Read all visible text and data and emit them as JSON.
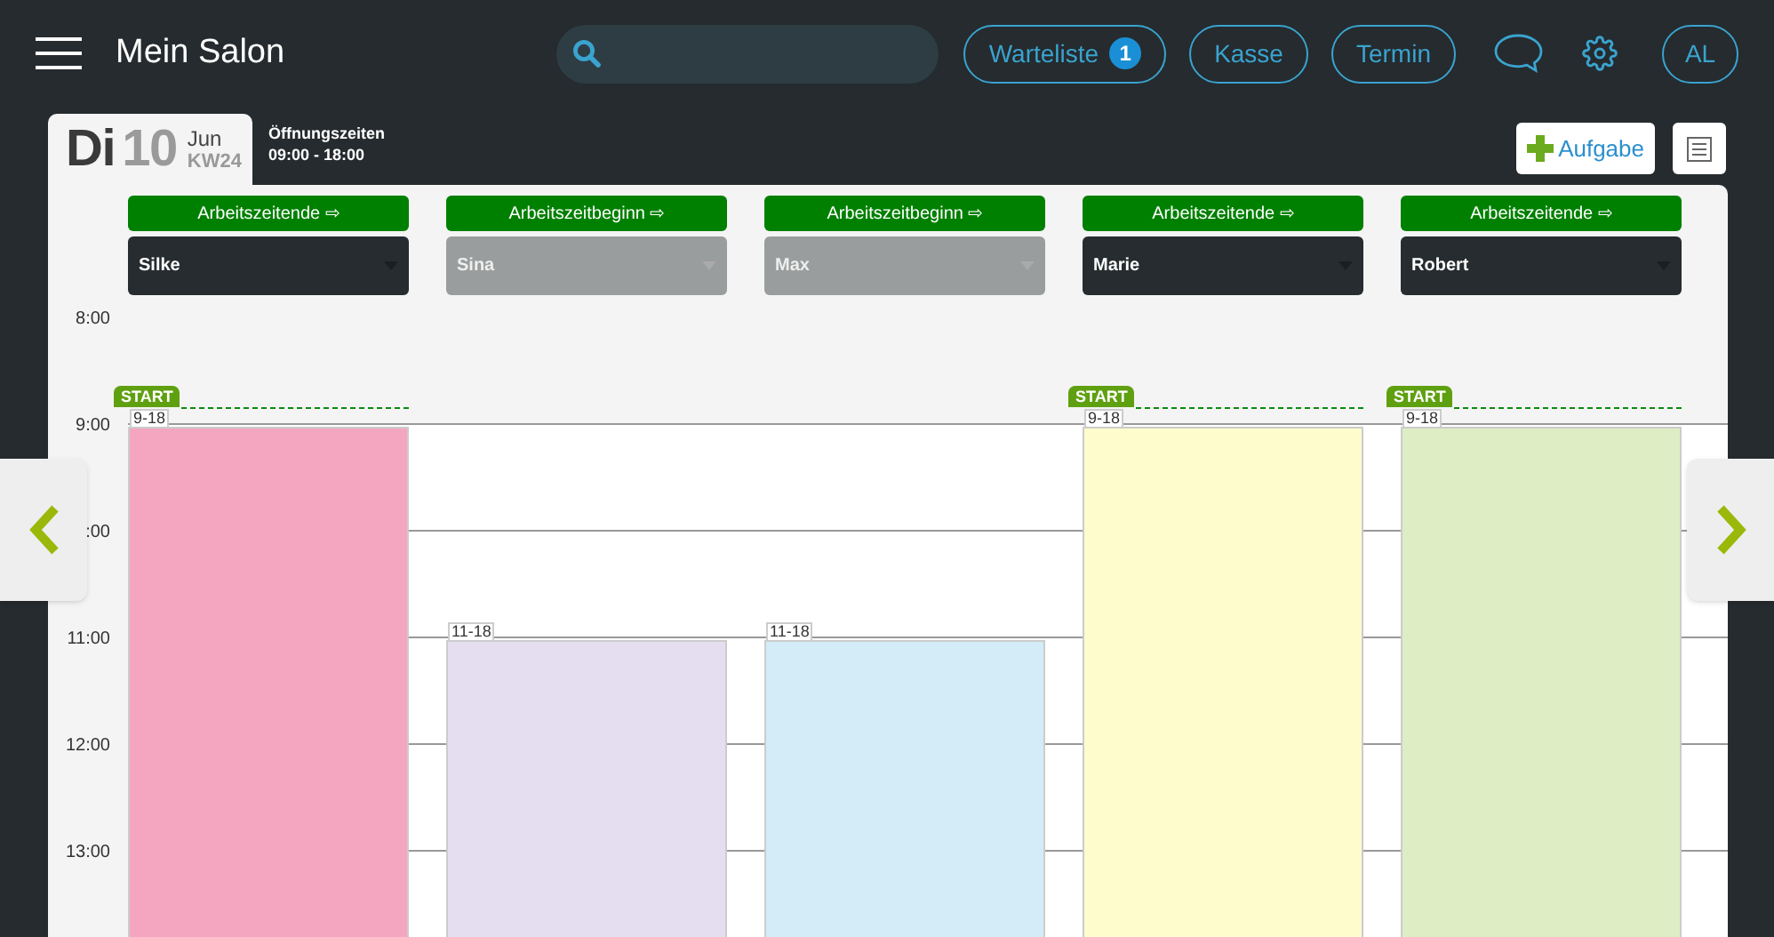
{
  "app_bar": {
    "title": "Mein Salon",
    "buttons": [
      {
        "label": "Warteliste",
        "badge": "1"
      },
      {
        "label": "Kasse"
      },
      {
        "label": "Termin"
      }
    ],
    "avatar": "AL"
  },
  "date": {
    "weekday": "Di",
    "day": "10",
    "month": "Jun",
    "week": "KW24",
    "hours_label": "Öffnungszeiten",
    "hours": "09:00 - 18:00"
  },
  "task_button": "Aufgabe",
  "time_labels": [
    "8:00",
    "9:00",
    ":00",
    "11:00",
    "12:00",
    "13:00"
  ],
  "staff": [
    {
      "action": "Arbeitszeitende ⇨",
      "name": "Silke",
      "disabled": false,
      "shift": "9-18",
      "start": true,
      "start_label": "START",
      "color": "#f4a6c0"
    },
    {
      "action": "Arbeitszeitbeginn ⇨",
      "name": "Sina",
      "disabled": true,
      "shift": "11-18",
      "start": false,
      "color": "#e5ddf0"
    },
    {
      "action": "Arbeitszeitbeginn ⇨",
      "name": "Max",
      "disabled": true,
      "shift": "11-18",
      "start": false,
      "color": "#d3ecf8"
    },
    {
      "action": "Arbeitszeitende ⇨",
      "name": "Marie",
      "disabled": false,
      "shift": "9-18",
      "start": true,
      "start_label": "START",
      "color": "#fefccc"
    },
    {
      "action": "Arbeitszeitende ⇨",
      "name": "Robert",
      "disabled": false,
      "shift": "9-18",
      "start": true,
      "start_label": "START",
      "color": "#deedc4"
    }
  ]
}
